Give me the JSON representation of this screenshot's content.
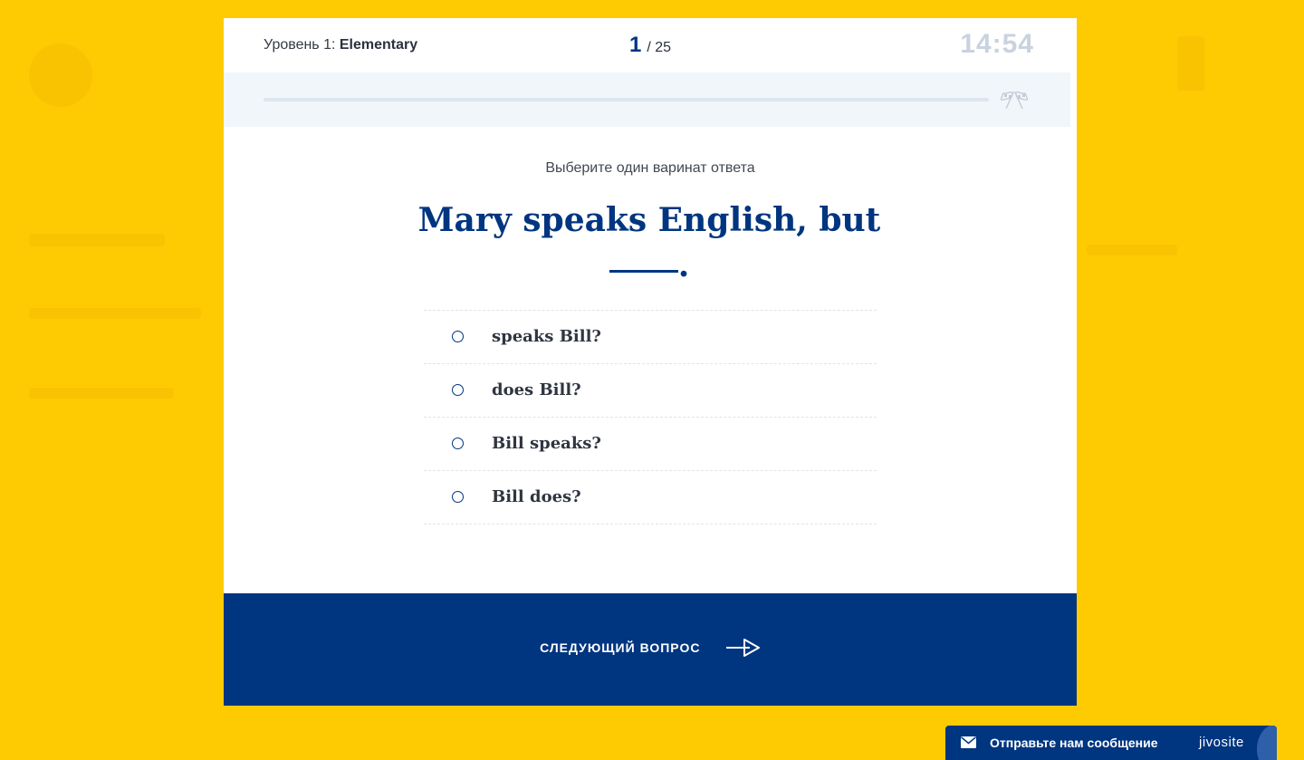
{
  "header": {
    "level_prefix": "Уровень 1:",
    "level_name": "Elementary",
    "current_question": "1",
    "total_questions": "/ 25",
    "timer": "14:54"
  },
  "progress": {
    "fraction": 0
  },
  "instruction": "Выберите один варинат ответа",
  "question": {
    "text": "Mary speaks English, but",
    "suffix": "."
  },
  "options": [
    {
      "label": "speaks Bill?"
    },
    {
      "label": "does Bill?"
    },
    {
      "label": "Bill speaks?"
    },
    {
      "label": "Bill does?"
    }
  ],
  "next_button": {
    "label": "СЛЕДУЮЩИЙ ВОПРОС"
  },
  "chat_widget": {
    "label": "Отправьте нам сообщение",
    "brand": "jivosite"
  },
  "colors": {
    "background": "#FECB02",
    "primary": "#003580",
    "timer": "#c9d3df",
    "progress_strip": "#f1f6fb"
  }
}
